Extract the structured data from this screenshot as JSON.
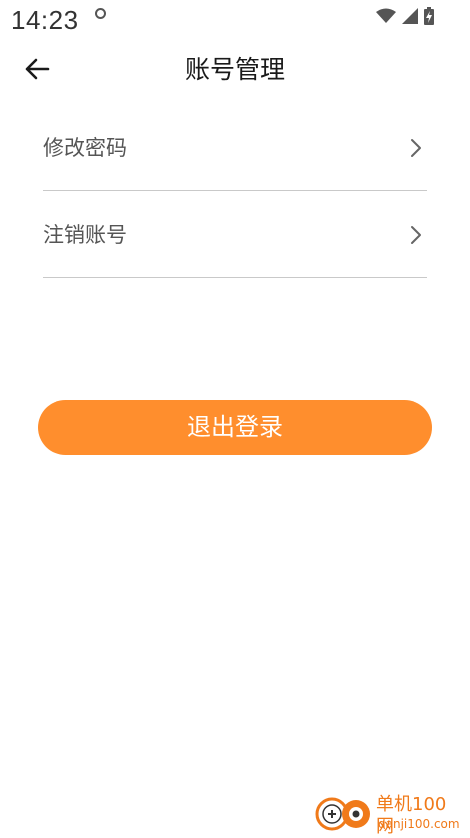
{
  "status_bar": {
    "time": "14:23"
  },
  "header": {
    "title": "账号管理",
    "back_icon": "arrow-left-icon"
  },
  "menu": {
    "items": [
      {
        "label": "修改密码",
        "icon": "chevron-right-icon"
      },
      {
        "label": "注销账号",
        "icon": "chevron-right-icon"
      }
    ]
  },
  "logout": {
    "label": "退出登录",
    "color": "#ff8e2d"
  },
  "watermark": {
    "title": "单机100网",
    "url": "danji100.com"
  }
}
